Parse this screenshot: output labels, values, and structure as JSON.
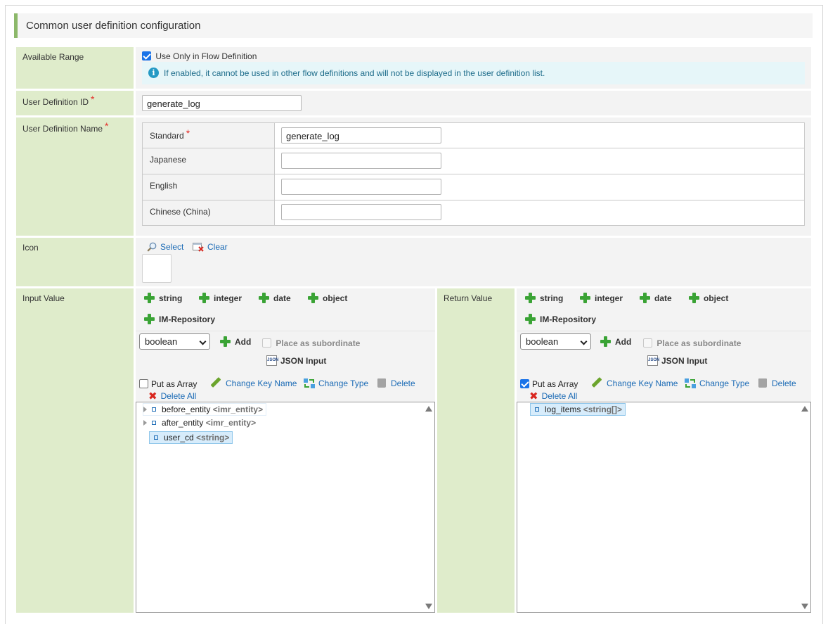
{
  "section_title": "Common user definition configuration",
  "available_range": {
    "label": "Available Range",
    "checkbox_label": "Use Only in Flow Definition",
    "checked": true,
    "info_text": "If enabled, it cannot be used in other flow definitions and will not be displayed in the user definition list."
  },
  "user_definition_id": {
    "label": "User Definition ID",
    "value": "generate_log"
  },
  "user_definition_name": {
    "label": "User Definition Name",
    "rows": [
      {
        "label": "Standard",
        "value": "generate_log",
        "required": true
      },
      {
        "label": "Japanese",
        "value": ""
      },
      {
        "label": "English",
        "value": ""
      },
      {
        "label": "Chinese (China)",
        "value": ""
      }
    ]
  },
  "icon": {
    "label": "Icon",
    "select_label": "Select",
    "clear_label": "Clear"
  },
  "input_value": {
    "label": "Input Value",
    "type_buttons": [
      "string",
      "integer",
      "date",
      "object",
      "IM-Repository"
    ],
    "type_select": "boolean",
    "add_label": "Add",
    "subordinate_label": "Place as subordinate",
    "json_label": "JSON Input",
    "put_as_array_label": "Put as Array",
    "put_as_array_checked": false,
    "change_key_label": "Change Key Name",
    "change_type_label": "Change Type",
    "delete_label": "Delete",
    "delete_all_label": "Delete All",
    "tree": [
      {
        "name": "before_entity",
        "type": "<imr_entity>",
        "expandable": true
      },
      {
        "name": "after_entity",
        "type": "<imr_entity>",
        "expandable": true
      },
      {
        "name": "user_cd",
        "type": "<string>",
        "selected": true
      }
    ]
  },
  "return_value": {
    "label": "Return Value",
    "type_buttons": [
      "string",
      "integer",
      "date",
      "object",
      "IM-Repository"
    ],
    "type_select": "boolean",
    "add_label": "Add",
    "subordinate_label": "Place as subordinate",
    "json_label": "JSON Input",
    "put_as_array_label": "Put as Array",
    "put_as_array_checked": true,
    "change_key_label": "Change Key Name",
    "change_type_label": "Change Type",
    "delete_label": "Delete",
    "delete_all_label": "Delete All",
    "tree": [
      {
        "name": "log_items",
        "type": "<string[]>",
        "selected": true
      }
    ]
  },
  "colors": {
    "label_bg": "#dfeccb",
    "accent_green": "#8cb86a",
    "link_blue": "#1a6ab5",
    "required_red": "#e3312b"
  }
}
